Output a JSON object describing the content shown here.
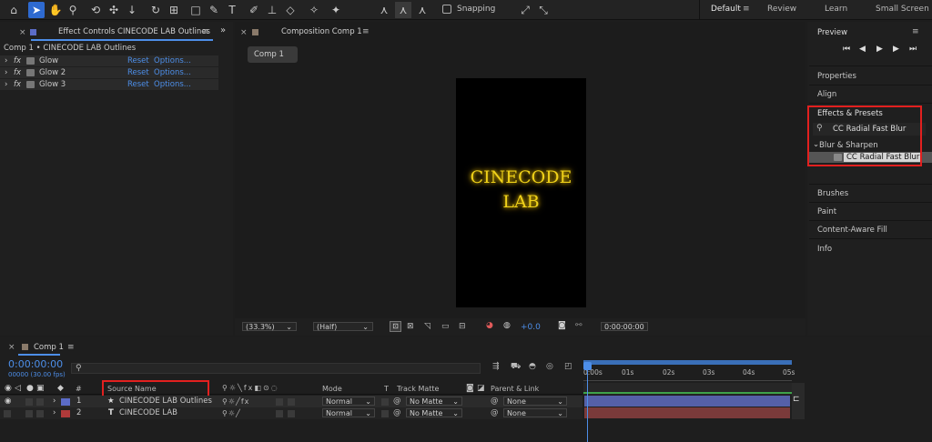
{
  "toolbar": {
    "snapping_label": "Snapping",
    "workspaces": [
      "Default",
      "Review",
      "Learn",
      "Small Screen"
    ]
  },
  "effect_controls": {
    "tab_label": "Effect Controls CINECODE LAB Outlines",
    "breadcrumb": "Comp 1 • CINECODE LAB Outlines",
    "effects": [
      {
        "name": "Glow",
        "reset": "Reset",
        "options": "Options..."
      },
      {
        "name": "Glow 2",
        "reset": "Reset",
        "options": "Options..."
      },
      {
        "name": "Glow 3",
        "reset": "Reset",
        "options": "Options..."
      }
    ]
  },
  "composition": {
    "tab_label": "Composition Comp 1",
    "comp_button": "Comp 1",
    "canvas_text_line1": "CINECODE",
    "canvas_text_line2": "LAB",
    "zoom": "(33.3%)",
    "resolution": "(Half)",
    "exposure": "+0.0",
    "timecode": "0:00:00:00"
  },
  "right_panel": {
    "preview_label": "Preview",
    "properties": "Properties",
    "align": "Align",
    "effects_presets": "Effects & Presets",
    "search_value": "CC Radial Fast Blur",
    "category": "Blur & Sharpen",
    "result": "CC Radial Fast Blur",
    "brushes": "Brushes",
    "paint": "Paint",
    "content_aware_fill": "Content-Aware Fill",
    "info": "Info"
  },
  "timeline": {
    "tab_label": "Comp 1",
    "timecode": "0:00:00:00",
    "fps": "00000 (30.00 fps)",
    "col_source_name": "Source Name",
    "col_mode": "Mode",
    "col_t": "T",
    "col_track_matte": "Track Matte",
    "col_parent": "Parent & Link",
    "col_number": "#",
    "ruler": [
      "0:00s",
      "01s",
      "02s",
      "03s",
      "04s",
      "05s"
    ],
    "layers": [
      {
        "num": "1",
        "name": "CINECODE LAB Outlines",
        "mode": "Normal",
        "matte": "No Matte",
        "parent": "None",
        "color": "#5b6cc8"
      },
      {
        "num": "2",
        "name": "CINECODE LAB",
        "mode": "Normal",
        "matte": "No Matte",
        "parent": "None",
        "color": "#b03a3a"
      }
    ]
  },
  "colors": {
    "accent_blue": "#2e6ad0",
    "highlight_red": "#e2201f",
    "glow_yellow": "#f0d21a"
  }
}
